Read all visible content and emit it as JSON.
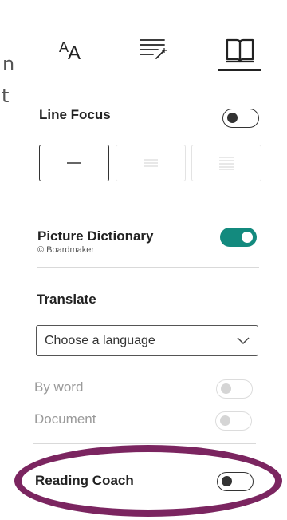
{
  "background": {
    "line1_fragment": "n",
    "line2_fragment": "t"
  },
  "tabs": {
    "text_size_icon": "text-size-icon",
    "text_preferences_icon": "text-preferences-icon",
    "reading_preferences_icon": "book-icon",
    "active": "reading_preferences"
  },
  "line_focus": {
    "label": "Line Focus",
    "enabled": false,
    "options": [
      "one-line",
      "three-lines",
      "five-lines"
    ],
    "selected_option": "one-line"
  },
  "picture_dictionary": {
    "label": "Picture Dictionary",
    "credit": "© Boardmaker",
    "enabled": true
  },
  "translate": {
    "label": "Translate",
    "select_value": "Choose a language",
    "by_word_label": "By word",
    "by_word_enabled": false,
    "document_label": "Document",
    "document_enabled": false
  },
  "reading_coach": {
    "label": "Reading Coach",
    "enabled": false
  },
  "colors": {
    "accent": "#138a7e",
    "highlight": "#7b2560"
  }
}
